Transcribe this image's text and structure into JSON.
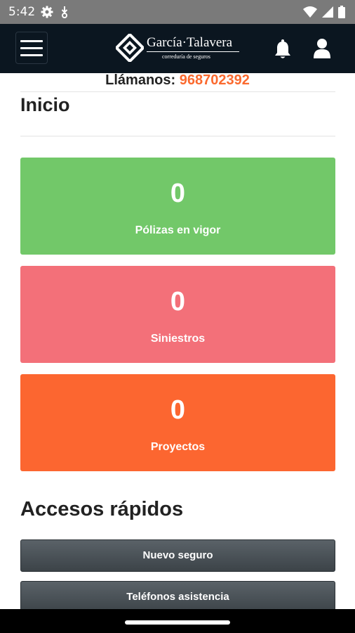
{
  "status_bar": {
    "time": "5:42",
    "icons": [
      "settings-icon",
      "download-icon",
      "wifi-icon",
      "signal-icon",
      "battery-icon"
    ]
  },
  "header": {
    "logo_name": "García·Talavera",
    "logo_tagline": "correduría de seguros",
    "icons": [
      "menu-icon",
      "bell-icon",
      "user-icon"
    ]
  },
  "contact": {
    "label": "Llámanos:",
    "phone": "968702392"
  },
  "page": {
    "title": "Inicio"
  },
  "stats": [
    {
      "value": "0",
      "label": "Pólizas en vigor",
      "color": "#72c869"
    },
    {
      "value": "0",
      "label": "Siniestros",
      "color": "#f37079"
    },
    {
      "value": "0",
      "label": "Proyectos",
      "color": "#fc6630"
    }
  ],
  "quick_access": {
    "title": "Accesos rápidos",
    "buttons": [
      "Nuevo seguro",
      "Teléfonos asistencia"
    ]
  },
  "colors": {
    "header_bg": "#0b1620",
    "accent_orange": "#fb6a2f",
    "button_dark": "#4a5157"
  }
}
